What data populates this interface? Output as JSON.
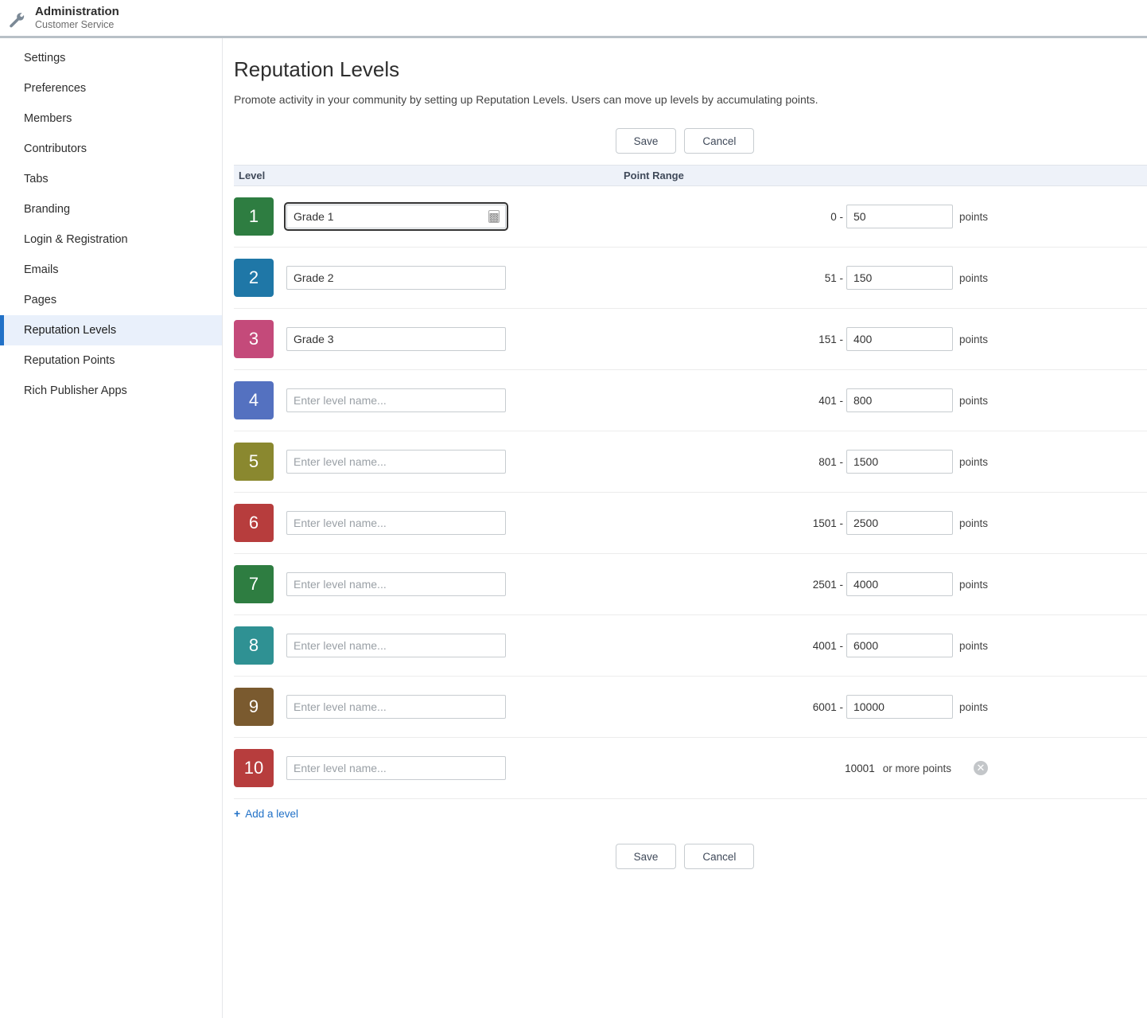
{
  "header": {
    "title": "Administration",
    "subtitle": "Customer Service"
  },
  "sidebar": {
    "items": [
      {
        "label": "Settings",
        "active": false
      },
      {
        "label": "Preferences",
        "active": false
      },
      {
        "label": "Members",
        "active": false
      },
      {
        "label": "Contributors",
        "active": false
      },
      {
        "label": "Tabs",
        "active": false
      },
      {
        "label": "Branding",
        "active": false
      },
      {
        "label": "Login & Registration",
        "active": false
      },
      {
        "label": "Emails",
        "active": false
      },
      {
        "label": "Pages",
        "active": false
      },
      {
        "label": "Reputation Levels",
        "active": true
      },
      {
        "label": "Reputation Points",
        "active": false
      },
      {
        "label": "Rich Publisher Apps",
        "active": false
      }
    ]
  },
  "page": {
    "title": "Reputation Levels",
    "description": "Promote activity in your community by setting up Reputation Levels. Users can move up levels by accumulating points.",
    "save_label": "Save",
    "cancel_label": "Cancel",
    "add_level_label": "Add a level"
  },
  "columns": {
    "level": "Level",
    "point_range": "Point Range"
  },
  "level_name_placeholder": "Enter level name...",
  "points_suffix": "points",
  "or_more_suffix": "or more points",
  "dash": "-",
  "levels": [
    {
      "num": "1",
      "name": "Grade 1",
      "start": "0",
      "end": "50",
      "color": "#2e7d41",
      "focused": true,
      "show_icon": true
    },
    {
      "num": "2",
      "name": "Grade 2",
      "start": "51",
      "end": "150",
      "color": "#1f77a7"
    },
    {
      "num": "3",
      "name": "Grade 3",
      "start": "151",
      "end": "400",
      "color": "#c44a7a"
    },
    {
      "num": "4",
      "name": "",
      "start": "401",
      "end": "800",
      "color": "#5471c0"
    },
    {
      "num": "5",
      "name": "",
      "start": "801",
      "end": "1500",
      "color": "#8a882f"
    },
    {
      "num": "6",
      "name": "",
      "start": "1501",
      "end": "2500",
      "color": "#b73d3d"
    },
    {
      "num": "7",
      "name": "",
      "start": "2501",
      "end": "4000",
      "color": "#2e7d41"
    },
    {
      "num": "8",
      "name": "",
      "start": "4001",
      "end": "6000",
      "color": "#2f9193"
    },
    {
      "num": "9",
      "name": "",
      "start": "6001",
      "end": "10000",
      "color": "#7a5a2f"
    },
    {
      "num": "10",
      "name": "",
      "start": "10001",
      "end": null,
      "color": "#b73d3d",
      "removable": true
    }
  ]
}
